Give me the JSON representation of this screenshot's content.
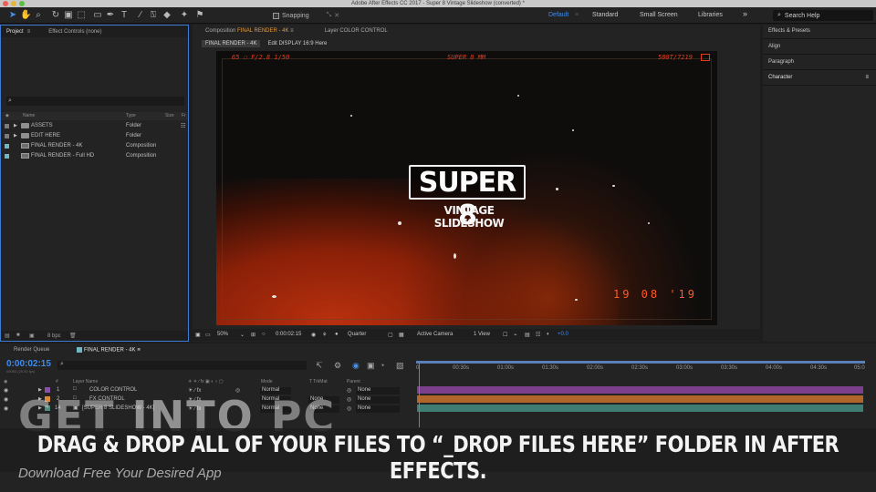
{
  "window": {
    "title": "Adobe After Effects CC 2017 - Super 8 Vintage Slideshow (converted) *"
  },
  "toolbar": {
    "snapping_label": "Snapping",
    "workspaces": [
      "Default",
      "Standard",
      "Small Screen",
      "Libraries"
    ],
    "more": "»",
    "search_help": "Search Help"
  },
  "project": {
    "tabs": [
      "Project",
      "Effect Controls (none)"
    ],
    "columns": {
      "name": "Name",
      "type": "Type",
      "size": "Size",
      "fr": "Fr"
    },
    "items": [
      {
        "name": "ASSETS",
        "type": "Folder",
        "color": "#7b7b7b"
      },
      {
        "name": "EDIT HERE",
        "type": "Folder",
        "color": "#7b7b7b"
      },
      {
        "name": "FINAL RENDER - 4K",
        "type": "Composition",
        "color": "#6fb7c2"
      },
      {
        "name": "FINAL RENDER - Full HD",
        "type": "Composition",
        "color": "#6fb7c2"
      }
    ],
    "bpc": "8 bpc"
  },
  "comp": {
    "tab_comp_prefix": "Composition",
    "tab_comp_name": "FINAL RENDER - 4K",
    "tab_layer": "Layer COLOR CONTROL",
    "crumb_active": "FINAL RENDER - 4K",
    "crumb_2": "Edit DISPLAY 16:9 Here",
    "hud_left": "65 ☐ F/2.8 1/50",
    "hud_center": "SUPER 8 MM",
    "hud_right": "500T/7219",
    "date_stamp": "19 08 '19",
    "title": "SUPER 8",
    "subtitle": "VINTAGE SLIDESHOW",
    "footer": {
      "zoom": "50%",
      "time": "0:00:02:15",
      "resolution": "Quarter",
      "camera": "Active Camera",
      "view": "1 View",
      "exposure": "+0.0"
    }
  },
  "right_panel": {
    "items": [
      "Effects & Presets",
      "Align",
      "Paragraph",
      "Character"
    ]
  },
  "timeline": {
    "tabs": [
      "Render Queue",
      "FINAL RENDER - 4K"
    ],
    "timecode": "0:00:02:15",
    "fps": "00063 (25.00 fps)",
    "columns": {
      "num": "#",
      "layer_name": "Layer Name",
      "mode": "Mode",
      "trkmat": "T TrkMat",
      "parent": "Parent"
    },
    "layers": [
      {
        "num": "1",
        "name": "COLOR CONTROL",
        "mode": "Normal",
        "trkmat": "",
        "parent": "None",
        "color": "#8b4fa8"
      },
      {
        "num": "2",
        "name": "FX CONTROL",
        "mode": "Normal",
        "trkmat": "None",
        "parent": "None",
        "color": "#d98a3a"
      },
      {
        "num": "14",
        "name": "[SUPER 8 SLIDESHOW - 4K]",
        "mode": "Normal",
        "trkmat": "None",
        "parent": "None",
        "color": "#4f8a7f"
      }
    ],
    "ruler": [
      "0",
      "00:30s",
      "01:00s",
      "01:30s",
      "02:00s",
      "02:30s",
      "03:00s",
      "03:30s",
      "04:00s",
      "04:30s",
      "05:0"
    ],
    "bar_colors": [
      "#7b3f8c",
      "#b0652a",
      "#3e7c74"
    ]
  },
  "overlay": {
    "watermark_get": "GET",
    "watermark_into": "INTO",
    "watermark_pc": "PC",
    "caption": "DRAG & DROP ALL OF YOUR FILES TO “_DROP FILES HERE” FOLDER IN AFTER EFFECTS.",
    "tagline": "Download Free Your Desired App"
  }
}
